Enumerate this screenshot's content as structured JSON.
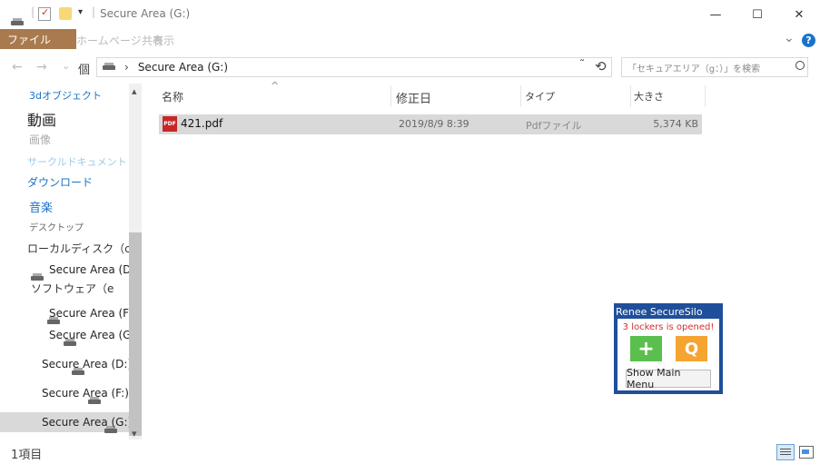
{
  "window": {
    "title": "Secure Area (G:)",
    "minimize_glyph": "—",
    "maximize_glyph": "☐",
    "close_glyph": "✕"
  },
  "ribbon": {
    "tabs": [
      "ファイル",
      "ホーム",
      "ページ",
      "共有",
      "表示"
    ],
    "expand_glyph": "⌄",
    "help_glyph": "?"
  },
  "nav": {
    "back": "←",
    "forward": "→",
    "recent": "⌄",
    "up": "個",
    "breadcrumb_sep": "›",
    "address": "Secure Area (G:)",
    "dropdown": "˜",
    "refresh": "⟲",
    "search_placeholder": "「セキュアエリア（g：）」を検索"
  },
  "sidebar": {
    "items": [
      {
        "label": "3dオブジェクト",
        "color": "#1a73c8"
      },
      {
        "label": "動画",
        "color": "#222222"
      },
      {
        "label": "画像",
        "color": "#aaaaaa"
      },
      {
        "label": "サークルドキュメント",
        "color": "#9ecbe8"
      },
      {
        "label": "ダウンロード",
        "color": "#1a73c8"
      },
      {
        "label": "音楽",
        "color": "#1a73c8"
      },
      {
        "label": "デスクトップ",
        "color": "#666666"
      },
      {
        "label": "ローカルディスク（c）",
        "color": "#333333"
      },
      {
        "label": "Secure Area (D",
        "color": "#222222"
      },
      {
        "label": "ソフトウェア（e",
        "color": "#333333"
      },
      {
        "label": "Secure Area (F:",
        "color": "#222222"
      },
      {
        "label": "Secure Area (G",
        "color": "#222222"
      },
      {
        "label": "Secure Area (D:)",
        "color": "#222222"
      },
      {
        "label": "Secure Area (F:)",
        "color": "#222222"
      },
      {
        "label": "Secure Area (G:)",
        "color": "#222222"
      }
    ],
    "scroll_up": "▴",
    "scroll_down": "▾"
  },
  "columns": {
    "name": "名称",
    "modified": "修正日",
    "type": "タイプ",
    "size": "大きさ",
    "sort_glyph": "^"
  },
  "files": [
    {
      "name": "421.pdf",
      "modified": "2019/8/9 8:39",
      "type": "Pdfファイル",
      "size": "5,374 KB",
      "icon": "PDF"
    }
  ],
  "popup": {
    "title": "Renee SecureSilo",
    "message": "3 lockers is opened!",
    "add_glyph": "+",
    "search_glyph": "Q",
    "menu_button": "Show Main Menu"
  },
  "status": {
    "count": "1項目"
  },
  "colors": {
    "file_tab": "#a97a4e",
    "popup_bg": "#1f4f9a",
    "add_green": "#5bbf4e",
    "search_orange": "#f5a431",
    "popup_message": "#d32f2f"
  }
}
